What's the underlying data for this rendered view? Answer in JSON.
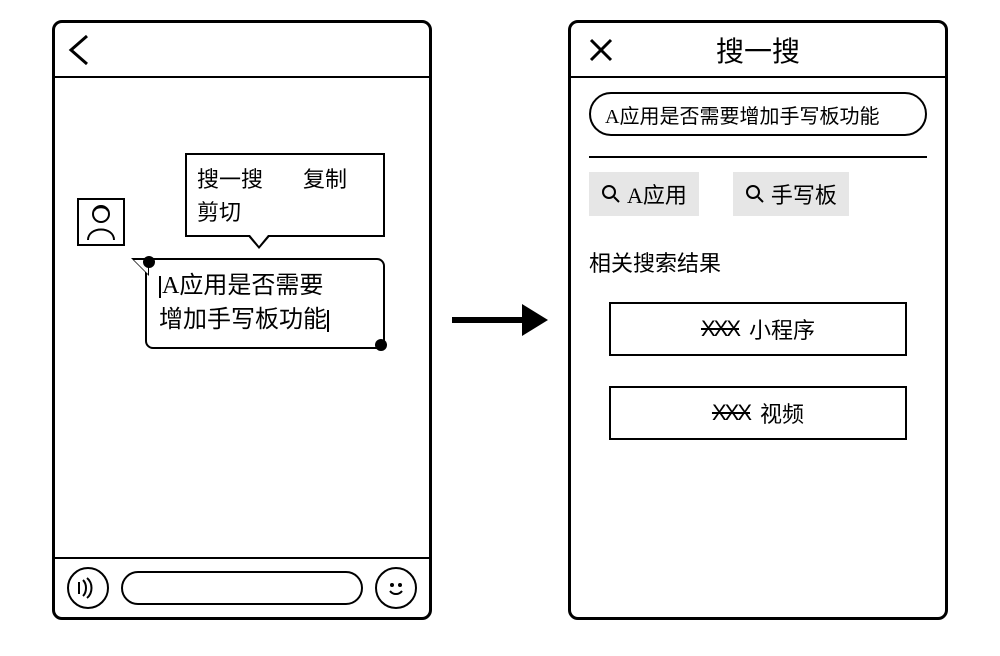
{
  "phone1": {
    "context_menu": {
      "search": "搜一搜",
      "copy": "复制",
      "cut": "剪切"
    },
    "message": {
      "line1": "A应用是否需要",
      "line2": "增加手写板功能"
    }
  },
  "phone2": {
    "title": "搜一搜",
    "search_value": "A应用是否需要增加手写板功能",
    "chips": {
      "app": "A应用",
      "handwrite": "手写板"
    },
    "section_label": "相关搜索结果",
    "results": {
      "placeholder": "XXX",
      "mini_program": "小程序",
      "video": "视频"
    }
  }
}
